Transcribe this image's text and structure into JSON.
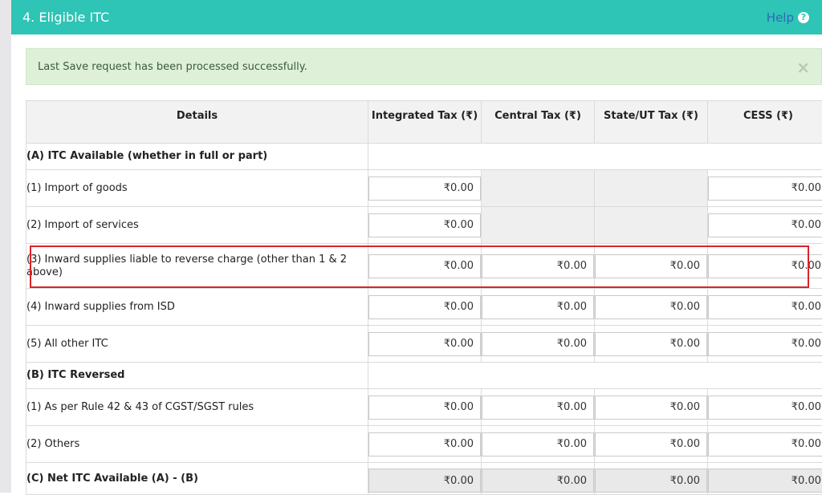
{
  "header": {
    "title": "4. Eligible ITC",
    "help_label": "Help",
    "help_icon": "question-circle-icon"
  },
  "alert": {
    "message": "Last Save request has been processed successfully.",
    "close_glyph": "×"
  },
  "table": {
    "columns": [
      "Details",
      "Integrated Tax (₹)",
      "Central Tax (₹)",
      "State/UT Tax (₹)",
      "CESS (₹)"
    ],
    "sections": {
      "a": "(A) ITC Available (whether in full or part)",
      "b": "(B) ITC Reversed",
      "c": "(C) Net ITC Available (A) - (B)"
    },
    "rows": {
      "a1": {
        "label": "(1) Import of goods",
        "igst": "₹0.00",
        "cess": "₹0.00"
      },
      "a2": {
        "label": "(2) Import of services",
        "igst": "₹0.00",
        "cess": "₹0.00"
      },
      "a3": {
        "label": "(3) Inward supplies liable to reverse charge (other than 1 & 2 above)",
        "igst": "₹0.00",
        "cgst": "₹0.00",
        "sgst": "₹0.00",
        "cess": "₹0.00"
      },
      "a4": {
        "label": "(4) Inward supplies from ISD",
        "igst": "₹0.00",
        "cgst": "₹0.00",
        "sgst": "₹0.00",
        "cess": "₹0.00"
      },
      "a5": {
        "label": "(5) All other ITC",
        "igst": "₹0.00",
        "cgst": "₹0.00",
        "sgst": "₹0.00",
        "cess": "₹0.00"
      },
      "b1": {
        "label": "(1) As per Rule 42 & 43 of CGST/SGST rules",
        "igst": "₹0.00",
        "cgst": "₹0.00",
        "sgst": "₹0.00",
        "cess": "₹0.00"
      },
      "b2": {
        "label": "(2) Others",
        "igst": "₹0.00",
        "cgst": "₹0.00",
        "sgst": "₹0.00",
        "cess": "₹0.00"
      },
      "c": {
        "igst": "₹0.00",
        "cgst": "₹0.00",
        "sgst": "₹0.00",
        "cess": "₹0.00"
      }
    }
  },
  "highlight_color": "#d9252a",
  "header_color": "#2ec4b6"
}
